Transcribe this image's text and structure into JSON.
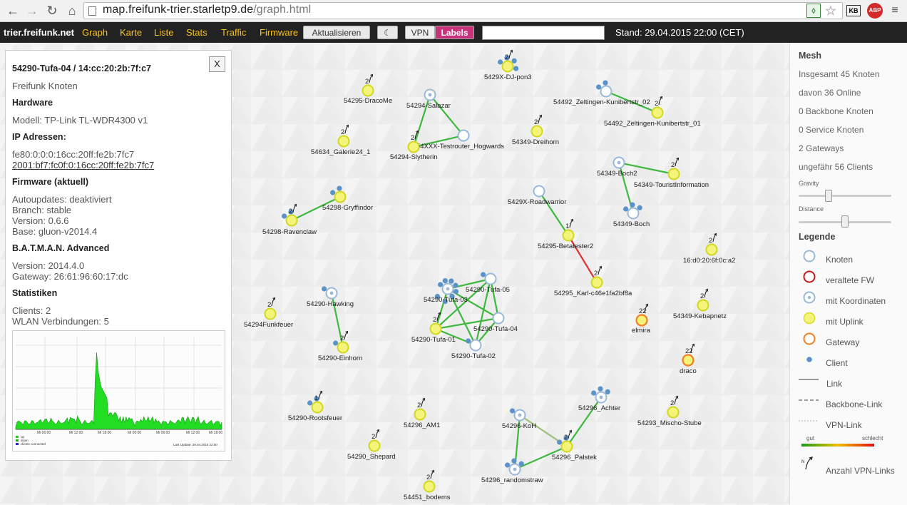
{
  "browser": {
    "url_host": "map.freifunk-trier.starletp9.de",
    "url_path": "/graph.html",
    "ext_labels": [
      "KB",
      "ABP"
    ]
  },
  "header": {
    "brand": "trier.freifunk.net",
    "nav": [
      "Graph",
      "Karte",
      "Liste",
      "Stats",
      "Traffic",
      "Firmware"
    ],
    "refresh": "Aktualisieren",
    "vpn": "VPN",
    "labels": "Labels",
    "search_value": "",
    "stand": "Stand: 29.04.2015 22:00 (CET)"
  },
  "info": {
    "title": "54290-Tufa-04 / 14:cc:20:2b:7f:c7",
    "subtitle": "Freifunk Knoten",
    "close": "X",
    "hardware_h": "Hardware",
    "model": "Modell: TP-Link TL-WDR4300 v1",
    "ip_h": "IP Adressen:",
    "ip1": "fe80:0:0:0:16cc:20ff:fe2b:7fc7",
    "ip2": "2001:bf7:fc0f:0:16cc:20ff:fe2b:7fc7",
    "fw_h": "Firmware (aktuell)",
    "autoupdates": "Autoupdates: deaktiviert",
    "branch": "Branch: stable",
    "version": "Version: 0.6.6",
    "base": "Base: gluon-v2014.4",
    "batman_h": "B.A.T.M.A.N. Advanced",
    "batman_version": "Version: 2014.4.0",
    "gateway": "Gateway: 26:61:96:60:17:dc",
    "stats_h": "Statistiken",
    "clients": "Clients: 2",
    "wlan": "WLAN Verbindungen: 5",
    "chart_time_labels": [
      "Mi 06:00",
      "Mi 12:00",
      "Mi 18:00",
      "Mi 00:00",
      "Mi 06:00",
      "Mi 12:00",
      "Mi 18:00"
    ],
    "chart_legend": [
      "up",
      "down",
      "clients connected"
    ],
    "chart_footer": "Last Update: 29.04.2015 22:00"
  },
  "sidebar": {
    "mesh_h": "Mesh",
    "total": "Insgesamt 45 Knoten",
    "online": "davon 36 Online",
    "backbone": "0 Backbone Knoten",
    "service": "0 Service Knoten",
    "gateways": "2 Gateways",
    "clients": "ungefähr 56 Clients",
    "gravity": "Gravity",
    "distance": "Distance",
    "legend_h": "Legende",
    "legend": [
      "Knoten",
      "veraltete FW",
      "mit Koordinaten",
      "mit Uplink",
      "Gateway",
      "Client",
      "Link",
      "Backbone-Link",
      "VPN-Link"
    ],
    "good": "gut",
    "bad": "schlecht",
    "vpn_count": "Anzahl VPN-Links",
    "colors": {
      "good": "#1a9a1a",
      "mid": "#f0c000",
      "bad": "#e01010"
    }
  },
  "graph": {
    "labels": [
      "5429X-DJ-pon3",
      "54295-DracoMe",
      "54294-Salazar",
      "54492_Zeltingen-Kunibertstr_02",
      "54492_Zeltingen-Kunibertstr_01",
      "54349-Dreihorn",
      "54XXX-Testrouter_Hogwards",
      "54294-Slytherin",
      "54634_Galerie24_1",
      "54349-Boch2",
      "54349-TouristInformation",
      "5429X-Roadwarrior",
      "54298-Gryffindor",
      "54298-Ravenclaw",
      "54349-Boch",
      "54295-Betatester2",
      "16:d0:20:6f:0c:a2",
      "54295_Karl-c46e1fa2bf8a",
      "54290-Tufa-05",
      "54290-Tufa-03",
      "54290-Hawking",
      "54294Funkfeuer",
      "54290-Tufa-04",
      "54290-Tufa-01",
      "54290-Tufa-02",
      "elmira",
      "54349-Kebapnetz",
      "54290-Einhorn",
      "draco",
      "54290-Rootsfeuer",
      "54296_AM1",
      "54296_Achter",
      "54293_Mischo-Stube",
      "54296-KoH",
      "54290_Shepard",
      "54296_Palstek",
      "54296_randomstraw",
      "54451_bodems"
    ]
  }
}
